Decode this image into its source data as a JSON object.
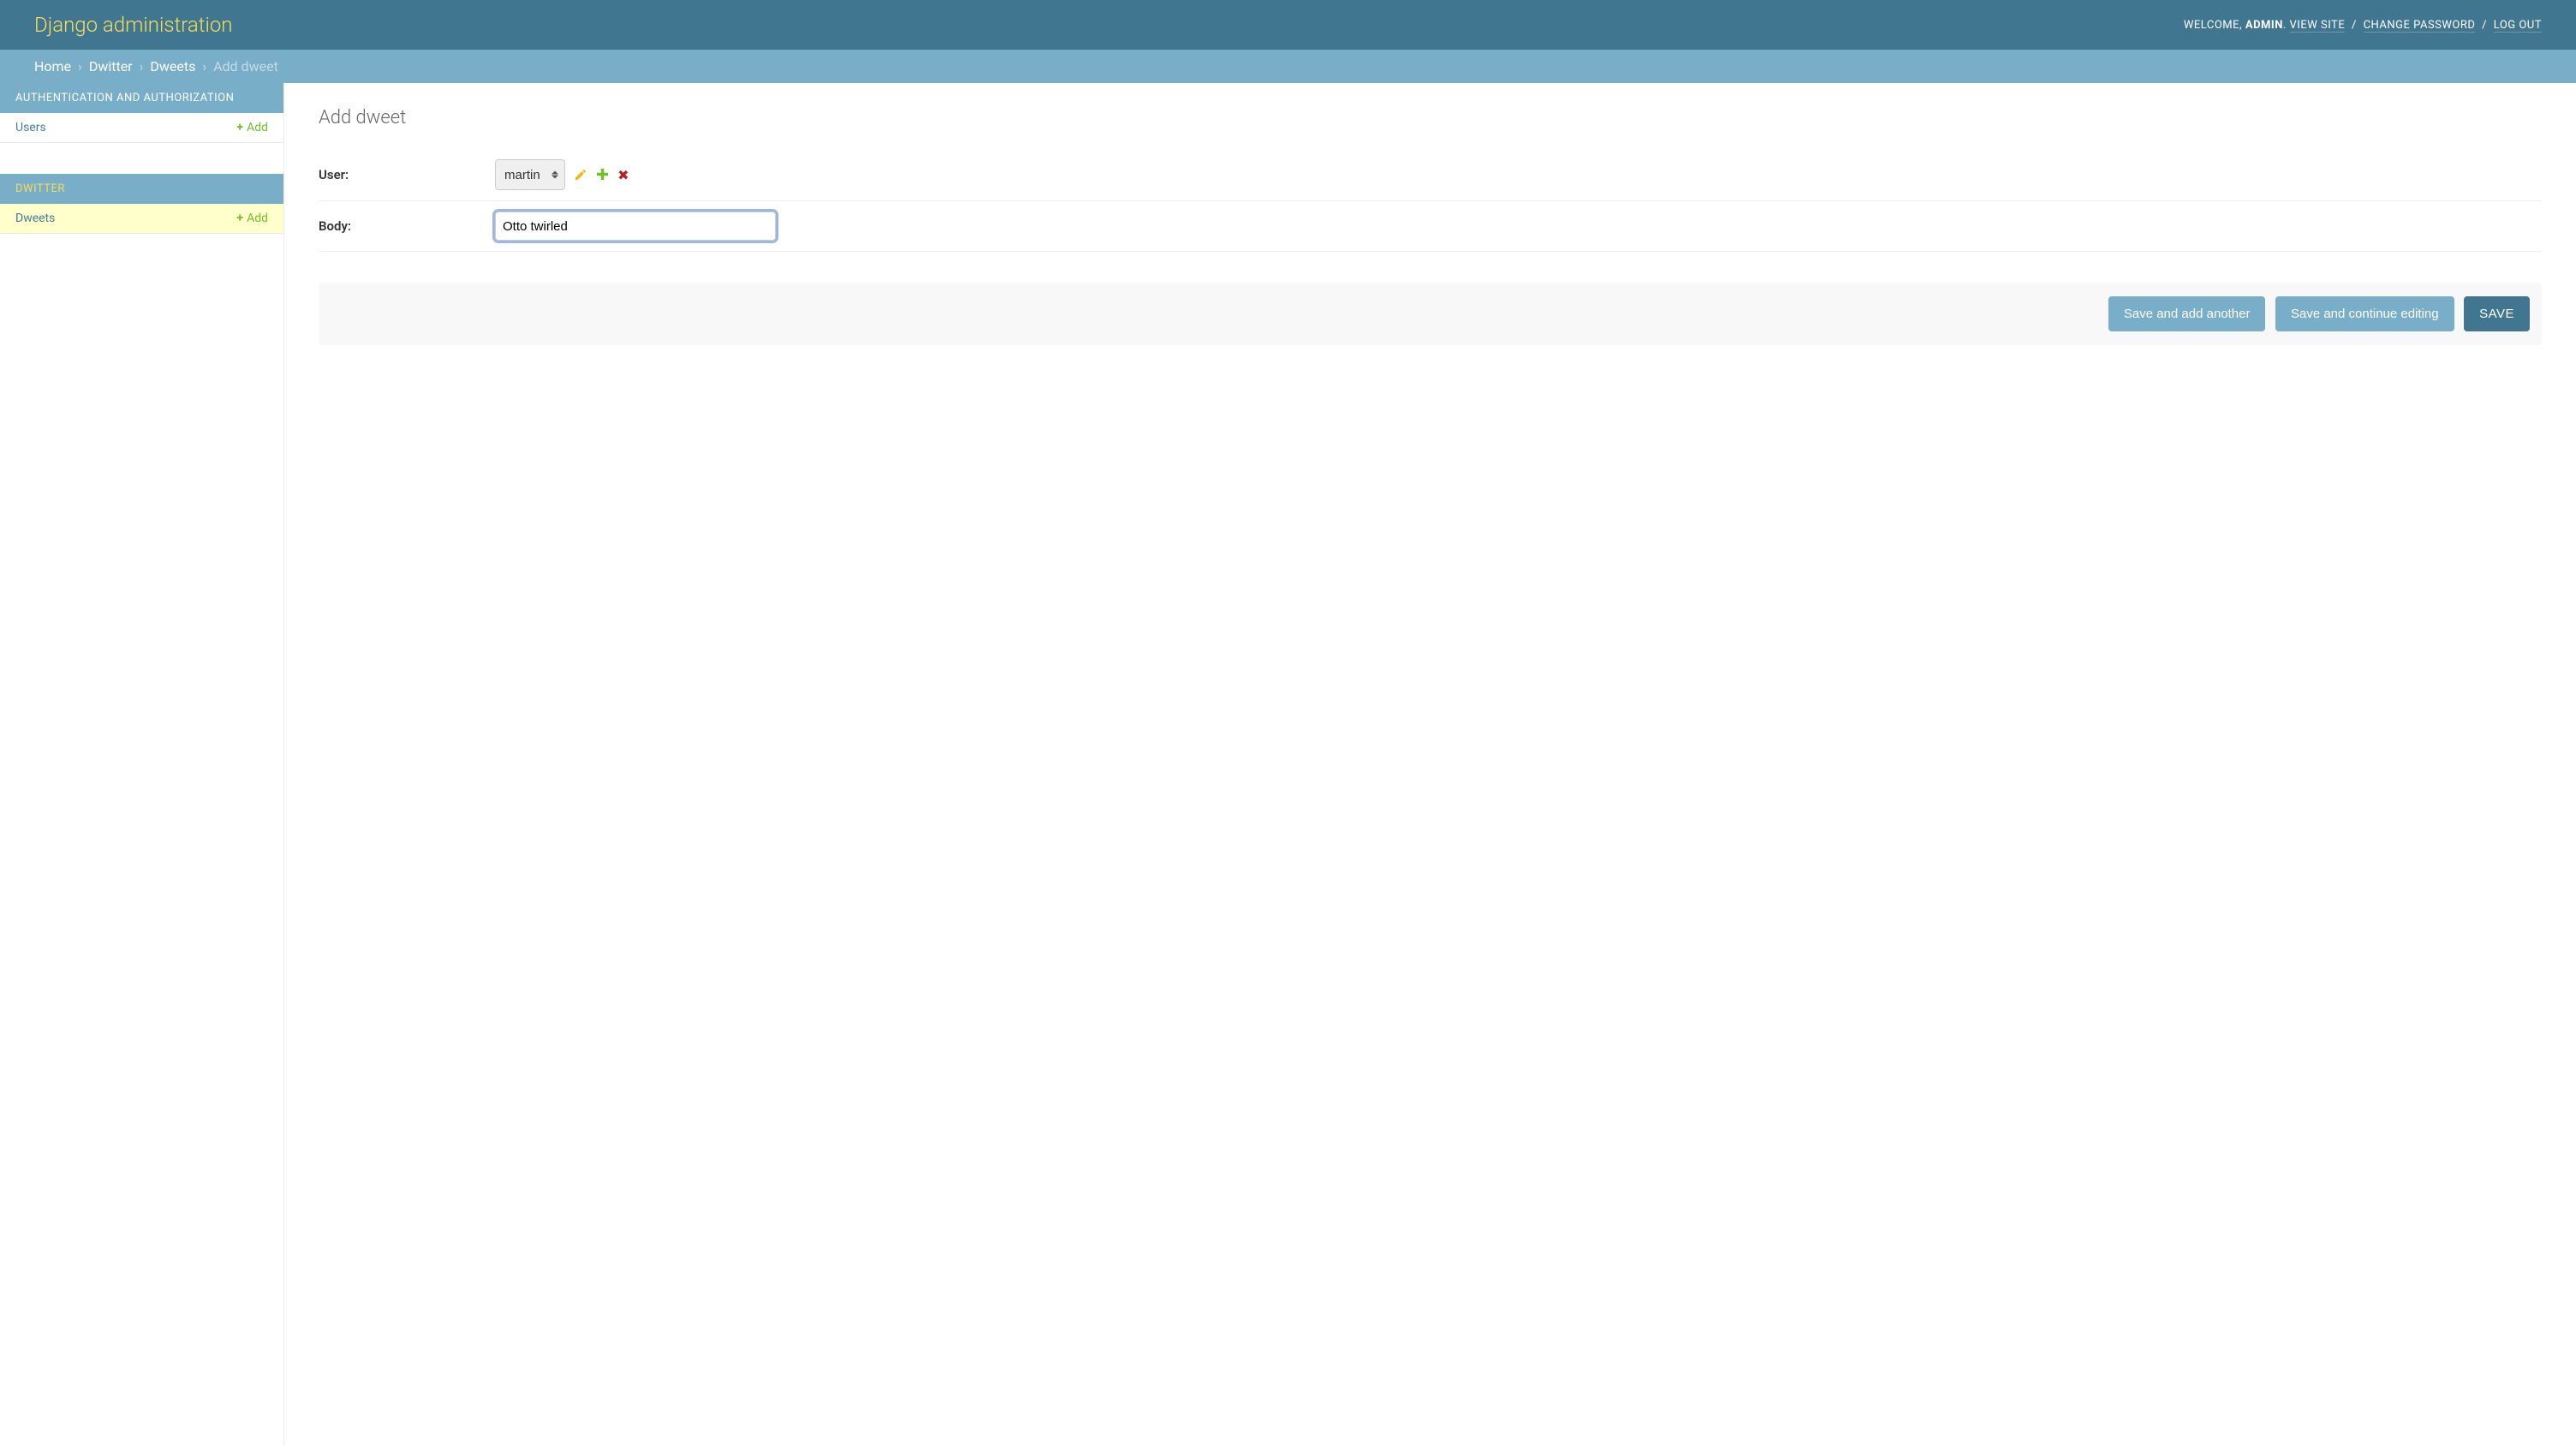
{
  "header": {
    "branding": "Django administration",
    "welcome": "WELCOME,",
    "username": "ADMIN",
    "view_site": "VIEW SITE",
    "change_password": "CHANGE PASSWORD",
    "log_out": "LOG OUT"
  },
  "breadcrumbs": {
    "home": "Home",
    "app": "Dwitter",
    "model": "Dweets",
    "current": "Add dweet"
  },
  "sidebar": {
    "apps": [
      {
        "caption": "AUTHENTICATION AND AUTHORIZATION",
        "models": [
          {
            "name": "Users",
            "add_label": "Add"
          }
        ]
      },
      {
        "caption": "DWITTER",
        "current": true,
        "models": [
          {
            "name": "Dweets",
            "add_label": "Add",
            "current": true
          }
        ]
      }
    ]
  },
  "content": {
    "title": "Add dweet",
    "fields": {
      "user": {
        "label": "User:",
        "value": "martin"
      },
      "body": {
        "label": "Body:",
        "value": "Otto twirled"
      }
    },
    "buttons": {
      "save_add_another": "Save and add another",
      "save_continue": "Save and continue editing",
      "save": "SAVE"
    }
  }
}
